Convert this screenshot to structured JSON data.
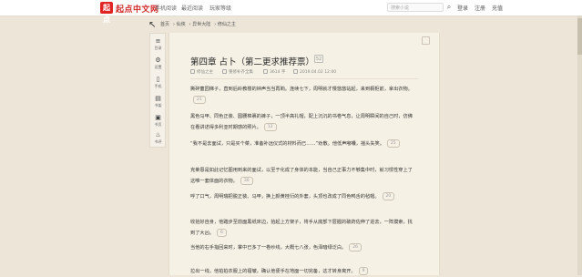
{
  "header": {
    "logo_glyph": "起点",
    "logo_text": "起点中文网",
    "nav": [
      "手机阅读",
      "最近阅读",
      "玩家等级"
    ],
    "search_placeholder": "搜索小说",
    "right": [
      "登录",
      "注册",
      "充值"
    ]
  },
  "breadcrumbs": [
    "首页",
    "仙侠",
    "异世大陆",
    "修仙之主"
  ],
  "sidebar": [
    {
      "icon": "menu-icon",
      "glyph": "≡",
      "label": "目录"
    },
    {
      "icon": "gear-icon",
      "glyph": "⚙",
      "label": "设置"
    },
    {
      "icon": "phone-icon",
      "glyph": "▯",
      "label": "手机"
    },
    {
      "icon": "book-icon",
      "glyph": "▤",
      "label": "书架"
    },
    {
      "icon": "document-icon",
      "glyph": "▣",
      "label": "书页"
    },
    {
      "icon": "hot-icon",
      "glyph": "♨",
      "label": "书评"
    }
  ],
  "chapter": {
    "title": "第四章 占卜（第二更求推荐票）",
    "badge": "52",
    "meta": [
      "修仙之主",
      "重修补齐全集",
      "3614 字",
      "2019.04.02 12:00"
    ]
  },
  "paragraphs": [
    {
      "text": "撕碎童园梯子，直到后岭教楼的钟声当当再晌。连续七下，周明就才慢悠悠站起，来到橱柜前，拿出衣物。",
      "count": "21"
    },
    {
      "text": "黑色马甲、同色正装、圆腰棉裹的裤子，一顶半高礼帽，配上沉沉的书卷气息，让周明瞬间的自己时，仿佛在看讲述得多利亚时期感的照片。",
      "count": "12"
    },
    {
      "text": "“我不是去面试，只是买个菜，准备补远仪式的材料而已……”劝散。他低声嘟囔，摇头失笑。",
      "count": "25"
    },
    {
      "text": "克莱恩是如此记忆图用到来的面试，以至于化成了身体的本能，当自己正事力不够集中时，就习惯性穿上了这唯一套体面的衣物。",
      "count": "30"
    },
    {
      "text": "呼了口气，周明瑞把脱正装、马甲，换上颜黄桂衍的外套，头顶也改成了同色鸭舌的毡帽。",
      "count": "20"
    },
    {
      "text": "收拾好自身，他踏步至前面黑纸床边，拾起上方架子，将手从底部下层握的破药佐伸了进去，一阵摸索，找到了大凶。",
      "count": "6"
    },
    {
      "text": "当他的右手指回来时，掌中已多了一卷纱线，大概七八张，色泽暗绿泛白。",
      "count": "26"
    },
    {
      "text": "拉出一线，他拍拍衣服上的褶皱，确认他便手在地面一切完备，这才转身离开。",
      "count": "9"
    }
  ]
}
